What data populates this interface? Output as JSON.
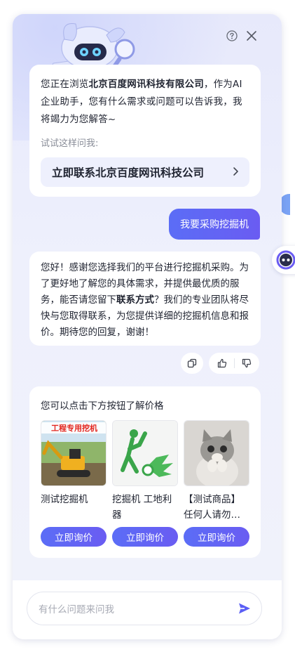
{
  "header": {
    "help_icon": "question-circle-icon",
    "close_icon": "close-icon"
  },
  "intro": {
    "prefix": "您正在浏览",
    "company": "北京百度网讯科技有限公司",
    "suffix": "，作为AI企业助手，您有什么需求或问题可以告诉我，我将竭力为您解答~",
    "try_label": "试试这样问我:",
    "suggestion": "立即联系北京百度网讯科技公司"
  },
  "user_message": "我要采购挖掘机",
  "reply": {
    "part1": "您好！感谢您选择我们的平台进行挖掘机采购。为了更好地了解您的具体需求，并提供最优质的服务，能否请您留下",
    "bold": "联系方式",
    "part2": "？我们的专业团队将尽快与您取得联系，为您提供详细的挖掘机信息和报价。期待您的回复，谢谢！"
  },
  "products": {
    "title": "您可以点击下方按钮了解价格",
    "items": [
      {
        "name": "测试挖掘机",
        "image_text": "工程专用挖机",
        "button": "立即询价"
      },
      {
        "name": "挖掘机 工地利器",
        "button": "立即询价"
      },
      {
        "name": "【测试商品】任何人请勿…",
        "button": "立即询价"
      }
    ]
  },
  "input": {
    "placeholder": "有什么问题来问我"
  },
  "colors": {
    "accent": "#5b6df6",
    "panel_bg": "#eef0fc"
  }
}
